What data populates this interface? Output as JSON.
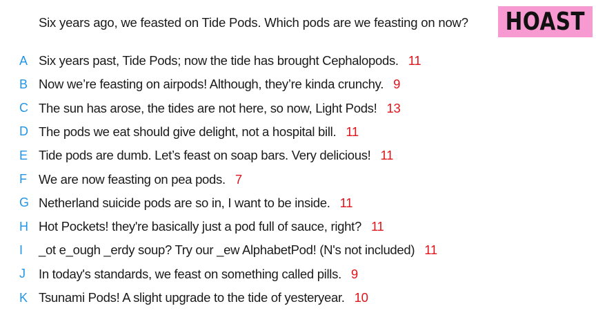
{
  "question": "Six years ago, we feasted on Tide Pods. Which pods are we feasting on now?",
  "badge": "HOAST",
  "colors": {
    "letter": "#2196e8",
    "score": "#e0151b",
    "badge_bg": "#f79ad2"
  },
  "answers": [
    {
      "letter": "A",
      "text": "Six years past, Tide Pods; now the tide has brought Cephalopods.",
      "score": "11"
    },
    {
      "letter": "B",
      "text": "Now we’re feasting on airpods! Although, they’re kinda crunchy.",
      "score": "9"
    },
    {
      "letter": "C",
      "text": "The sun has arose, the tides are not here, so now, Light Pods!",
      "score": "13"
    },
    {
      "letter": "D",
      "text": "The pods we eat should give delight, not a hospital bill.",
      "score": "11"
    },
    {
      "letter": "E",
      "text": "Tide pods are dumb. Let’s feast on soap bars. Very delicious!",
      "score": "11"
    },
    {
      "letter": "F",
      "text": "We are now feasting on pea pods.",
      "score": "7"
    },
    {
      "letter": "G",
      "text": "Netherland suicide pods are so in, I want to be inside.",
      "score": "11"
    },
    {
      "letter": "H",
      "text": "Hot Pockets! they're basically just a pod full of sauce, right?",
      "score": "11"
    },
    {
      "letter": "I",
      "text": "_ot e_ough _erdy soup? Try our _ew AlphabetPod! (N's not included)",
      "score": "11"
    },
    {
      "letter": "J",
      "text": "In today's standards, we feast on something called pills.",
      "score": "9"
    },
    {
      "letter": "K",
      "text": "Tsunami Pods! A slight upgrade to the tide of yesteryear.",
      "score": "10"
    }
  ]
}
